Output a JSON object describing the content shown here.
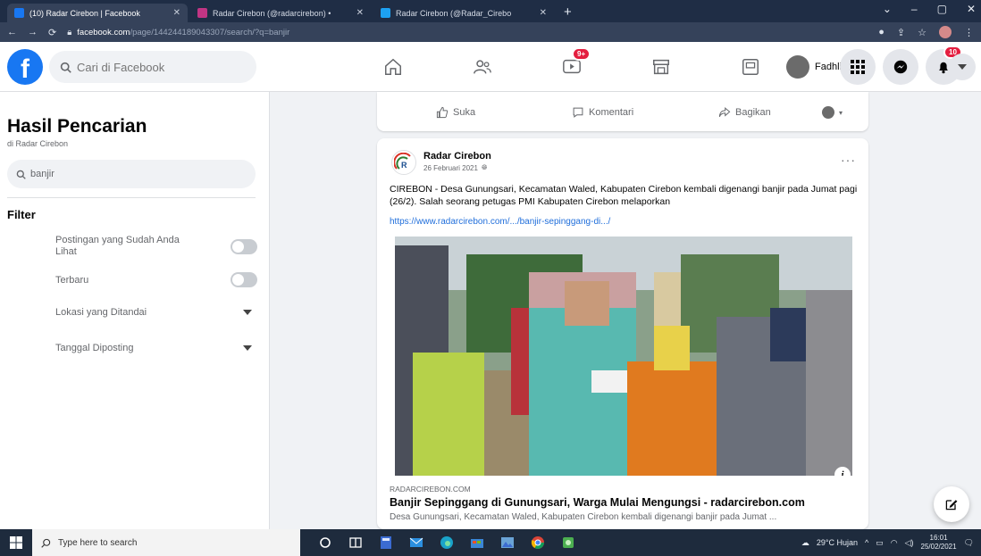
{
  "browser": {
    "tabs": [
      {
        "title": "(10) Radar Cirebon | Facebook",
        "favicon_color": "#1877f2",
        "active": true
      },
      {
        "title": "Radar Cirebon (@radarcirebon) •",
        "favicon_color": "#c13584",
        "active": false
      },
      {
        "title": "Radar Cirebon (@Radar_Cirebo",
        "favicon_color": "#1da1f2",
        "active": false
      }
    ],
    "new_tab": "+",
    "address": {
      "host": "facebook.com",
      "path": "/page/144244189043307/search/?q=banjir"
    }
  },
  "fb_nav": {
    "search_placeholder": "Cari di Facebook",
    "video_badge": "9+",
    "user_name": "Fadhli",
    "notif_badge": "10"
  },
  "sidebar": {
    "title": "Hasil Pencarian",
    "subtitle": "di Radar Cirebon",
    "search_value": "banjir",
    "filter_label": "Filter",
    "filters": [
      {
        "label": "Postingan yang Sudah Anda Lihat",
        "control": "toggle"
      },
      {
        "label": "Terbaru",
        "control": "toggle"
      },
      {
        "label": "Lokasi yang Ditandai",
        "control": "dropdown"
      },
      {
        "label": "Tanggal Diposting",
        "control": "dropdown"
      }
    ]
  },
  "prev_post_actions": {
    "like": "Suka",
    "comment": "Komentari",
    "share": "Bagikan"
  },
  "post": {
    "author": "Radar Cirebon",
    "date": "26 Februari 2021",
    "more": "···",
    "text": "CIREBON - Desa Gunungsari, Kecamatan Waled, Kabupaten Cirebon kembali digenangi banjir pada Jumat pagi (26/2). Salah seorang petugas PMI Kabupaten Cirebon melaporkan",
    "link": "https://www.radarcirebon.com/.../banjir-sepinggang-di.../",
    "image_info": "i",
    "link_preview": {
      "site": "RADARCIREBON.COM",
      "title": "Banjir Sepinggang di Gunungsari, Warga Mulai Mengungsi - radarcirebon.com",
      "description": "Desa Gunungsari, Kecamatan Waled, Kabupaten Cirebon kembali digenangi banjir pada Jumat ..."
    }
  },
  "taskbar": {
    "search_placeholder": "Type here to search",
    "weather": "29°C  Hujan",
    "time": "16:01",
    "date": "25/02/2021"
  },
  "colors": {
    "fb_blue": "#1877f2",
    "badge_red": "#e41e3f",
    "link_blue": "#216fdb"
  }
}
